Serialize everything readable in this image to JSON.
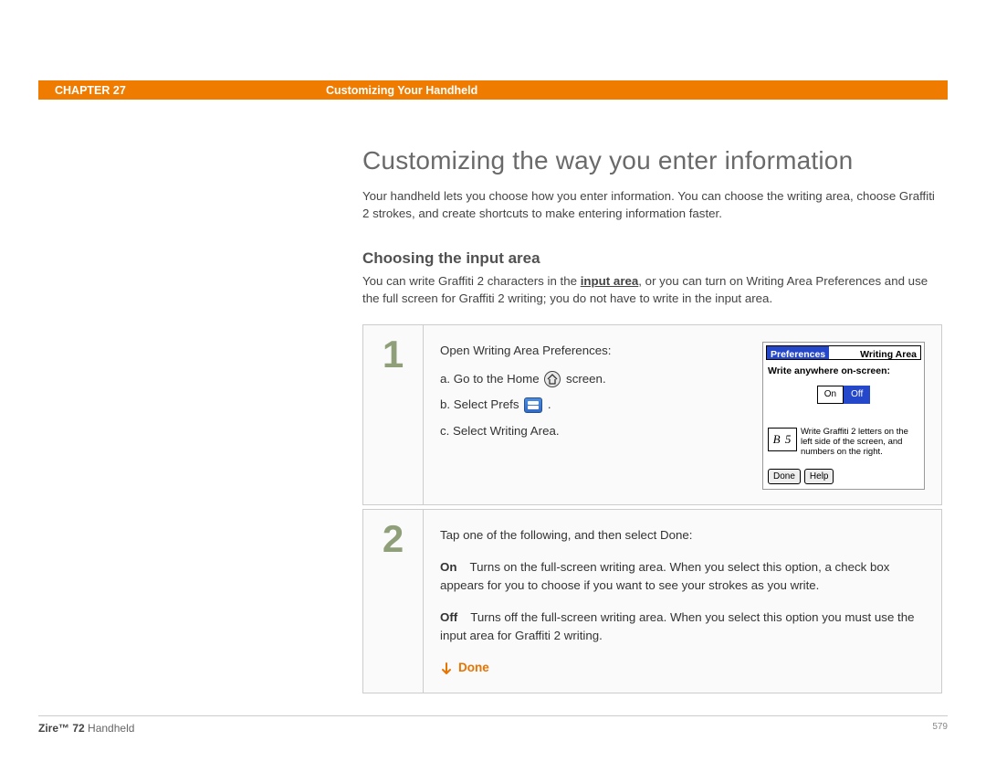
{
  "header": {
    "chapter": "CHAPTER 27",
    "title": "Customizing Your Handheld"
  },
  "main": {
    "h1": "Customizing the way you enter information",
    "intro": "Your handheld lets you choose how you enter information. You can choose the writing area, choose Graffiti 2 strokes, and create shortcuts to make entering information faster.",
    "h2": "Choosing the input area",
    "sub_intro_pre": "You can write Graffiti 2 characters in the ",
    "sub_intro_link": "input area",
    "sub_intro_post": ", or you can turn on Writing Area Preferences and use the full screen for Graffiti 2 writing; you do not have to write in the input area.",
    "step1": {
      "num": "1",
      "lead": "Open Writing Area Preferences:",
      "a_pre": "a.  Go to the Home ",
      "a_post": " screen.",
      "b_pre": "b.  Select Prefs ",
      "b_post": " .",
      "c": "c.  Select Writing Area."
    },
    "device": {
      "tab_left": "Preferences",
      "tab_right": "Writing Area",
      "subtitle": "Write anywhere on-screen:",
      "on": "On",
      "off": "Off",
      "glyph": "B 5",
      "info": "Write Graffiti 2 letters on the left side of the screen, and numbers on the right.",
      "done": "Done",
      "help": "Help"
    },
    "step2": {
      "num": "2",
      "lead": "Tap one of the following, and then select Done:",
      "on_label": "On",
      "on_text": "Turns on the full-screen writing area. When you select this option, a check box appears for you to choose if you want to see your strokes as you write.",
      "off_label": "Off",
      "off_text": "Turns off the full-screen writing area. When you select this option you must use the input area for Graffiti 2 writing.",
      "done": "Done"
    }
  },
  "footer": {
    "product_bold": "Zire™ 72",
    "product_rest": " Handheld",
    "page": "579"
  }
}
